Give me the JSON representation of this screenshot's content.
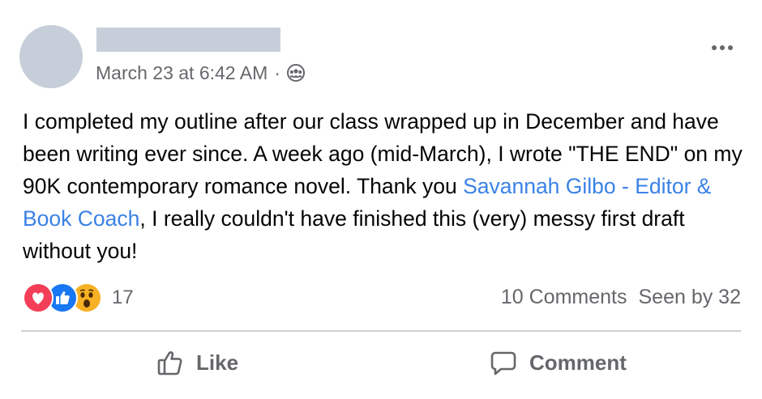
{
  "post": {
    "author_redacted": true,
    "timestamp": "March 23 at 6:42 AM",
    "separator": "·",
    "audience_icon": "group-icon",
    "text": {
      "intro": "I completed my outline after our class wrapped up in December and have been writing ever since. A week ago (mid-March), I wrote \"THE END\" on my 90K contemporary romance novel. Thank you ",
      "mention": "Savannah Gilbo - Editor & Book Coach",
      "outro": ", I really couldn't have finished this (very) messy first draft without you!"
    }
  },
  "reactions": {
    "types": [
      "love-icon",
      "like-icon",
      "wow-icon"
    ],
    "count": "17"
  },
  "stats": {
    "comments": "10 Comments",
    "seen_by": "Seen by 32"
  },
  "actions": {
    "like_label": "Like",
    "comment_label": "Comment"
  },
  "colors": {
    "link": "#3b82e6",
    "secondary_text": "#65676b",
    "placeholder": "#c6cfd9",
    "love": "#f33e58",
    "like": "#1877f2",
    "wow": "#f7b125"
  }
}
